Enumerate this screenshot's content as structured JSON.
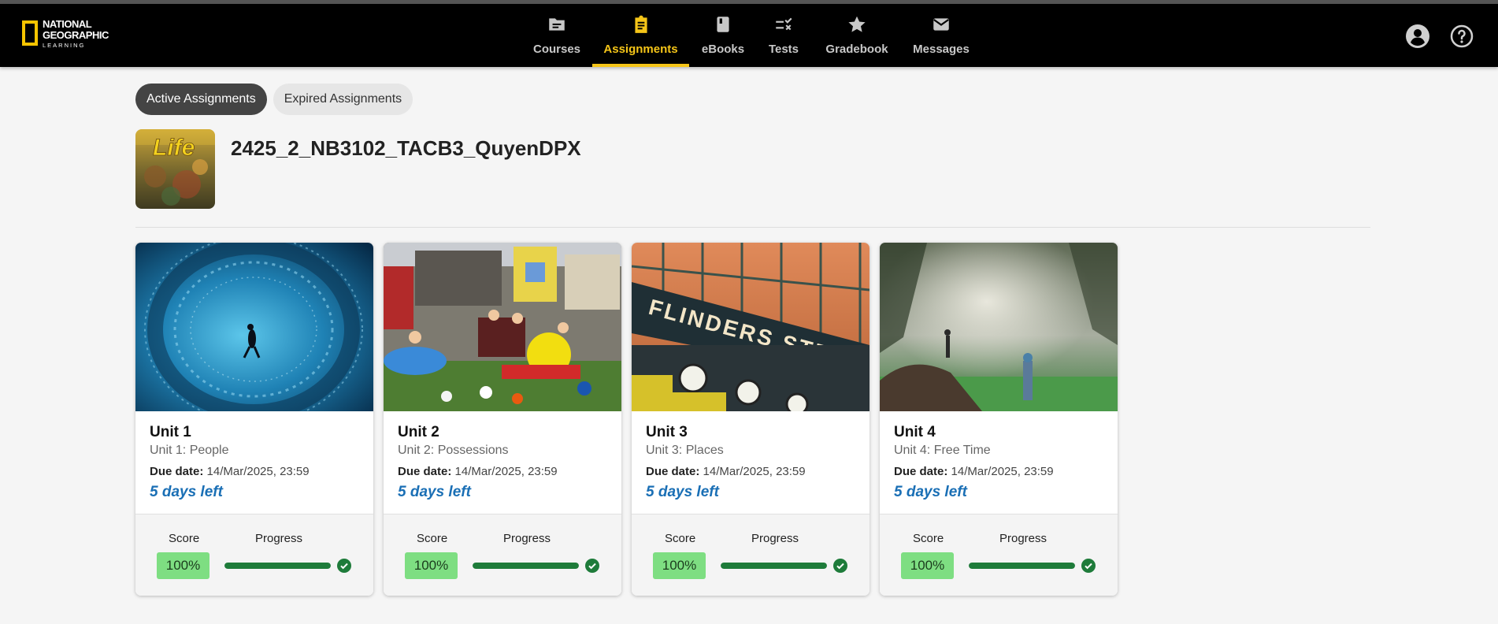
{
  "brand": {
    "line1": "NATIONAL",
    "line2": "GEOGRAPHIC",
    "line3": "LEARNING",
    "accent": "#f5c518"
  },
  "nav": {
    "items": [
      {
        "label": "Courses",
        "icon": "folder-icon"
      },
      {
        "label": "Assignments",
        "icon": "clipboard-icon",
        "active": true
      },
      {
        "label": "eBooks",
        "icon": "book-icon"
      },
      {
        "label": "Tests",
        "icon": "checklist-icon"
      },
      {
        "label": "Gradebook",
        "icon": "star-icon"
      },
      {
        "label": "Messages",
        "icon": "envelope-icon"
      }
    ],
    "right_icons": [
      "account-icon",
      "help-icon"
    ]
  },
  "tabs": [
    {
      "label": "Active Assignments",
      "active": true
    },
    {
      "label": "Expired Assignments",
      "active": false
    }
  ],
  "course": {
    "title": "2425_2_NB3102_TACB3_QuyenDPX",
    "thumb_text": "Life"
  },
  "cards": {
    "due_prefix": "Due date:",
    "score_label": "Score",
    "progress_label": "Progress",
    "items": [
      {
        "unit": "Unit 1",
        "subtitle": "Unit 1: People",
        "due": "14/Mar/2025, 23:59",
        "days_left": "5 days left",
        "score": "100%",
        "progress": 1.0,
        "image": "diver-fish-photo"
      },
      {
        "unit": "Unit 2",
        "subtitle": "Unit 2: Possessions",
        "due": "14/Mar/2025, 23:59",
        "days_left": "5 days left",
        "score": "100%",
        "progress": 1.0,
        "image": "family-possessions-photo"
      },
      {
        "unit": "Unit 3",
        "subtitle": "Unit 3: Places",
        "due": "14/Mar/2025, 23:59",
        "days_left": "5 days left",
        "score": "100%",
        "progress": 1.0,
        "image": "flinders-street-station-photo",
        "image_text": "FLINDERS STREET"
      },
      {
        "unit": "Unit 4",
        "subtitle": "Unit 4: Free Time",
        "due": "14/Mar/2025, 23:59",
        "days_left": "5 days left",
        "score": "100%",
        "progress": 1.0,
        "image": "fishing-river-photo"
      }
    ]
  }
}
